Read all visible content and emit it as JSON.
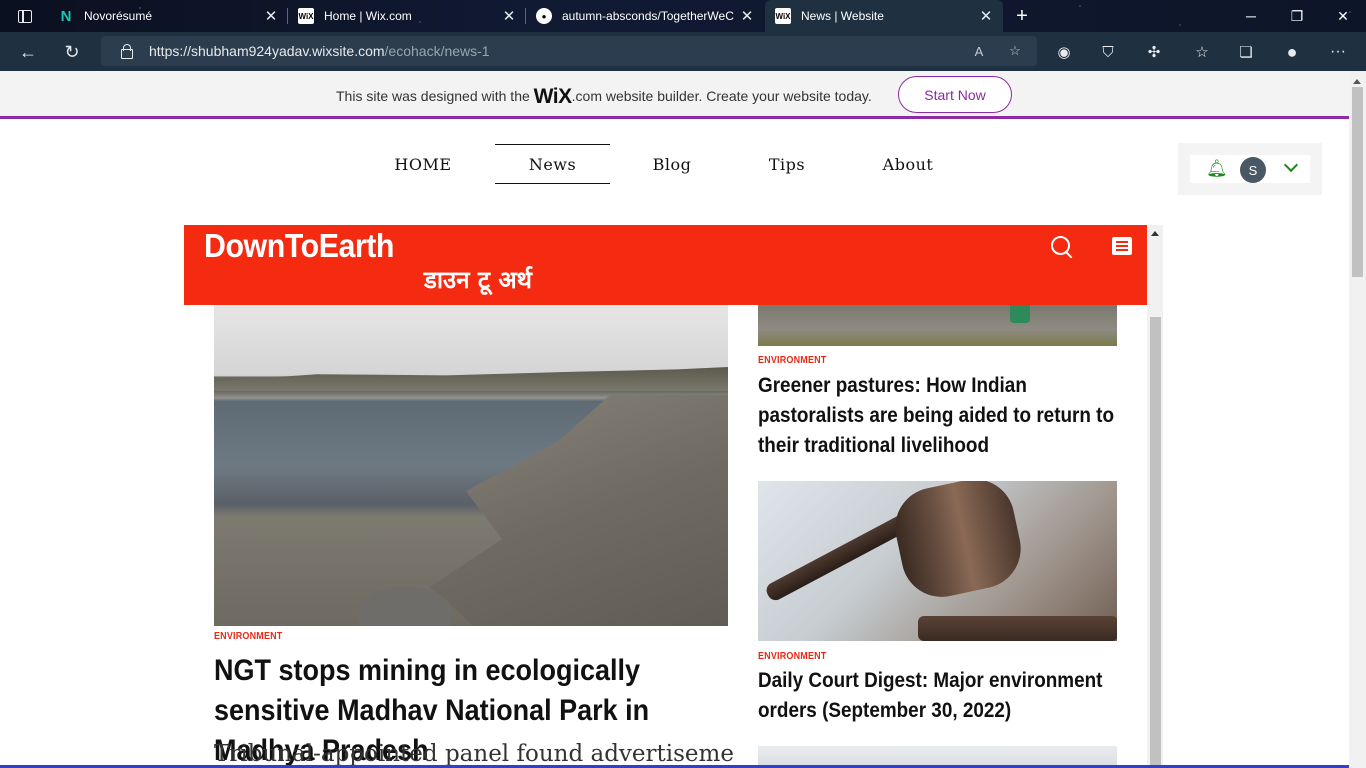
{
  "browser": {
    "tabs": [
      {
        "title": "Novorésumé",
        "favicon": "N"
      },
      {
        "title": "Home | Wix.com",
        "favicon": "WiX"
      },
      {
        "title": "autumn-absconds/TogetherWeC",
        "favicon": "GH"
      },
      {
        "title": "News | Website",
        "favicon": "WiX"
      }
    ],
    "address": {
      "host": "https://shubham924yadav.wixsite.com",
      "path": "/ecohack/news-1"
    }
  },
  "wix_banner": {
    "text_before": "This site was designed with the ",
    "brand": "WiX",
    "text_after": ".com website builder. Create your website today.",
    "cta": "Start Now"
  },
  "site_nav": {
    "items": [
      "HOME",
      "News",
      "Blog",
      "Tips",
      "About"
    ],
    "active": "News"
  },
  "member": {
    "avatar_initial": "S"
  },
  "dte": {
    "logo": "DownToEarth",
    "logo_hindi": "डाउन टू अर्थ",
    "main_story": {
      "category": "ENVIRONMENT",
      "headline": "NGT stops mining in ecologically sensitive Madhav National Park in Madhya Pradesh",
      "deck": "Tribunal-appointed panel found advertisements"
    },
    "side_stories": [
      {
        "category": "ENVIRONMENT",
        "headline": "Greener pastures: How Indian pastoralists are being aided to return to their traditional livelihood"
      },
      {
        "category": "ENVIRONMENT",
        "headline": "Daily Court Digest: Major environment orders (September 30, 2022)"
      }
    ]
  },
  "colors": {
    "dte_red": "#f42a11",
    "wix_purple": "#8e2aa3",
    "bell_green": "#1a8a1a"
  }
}
